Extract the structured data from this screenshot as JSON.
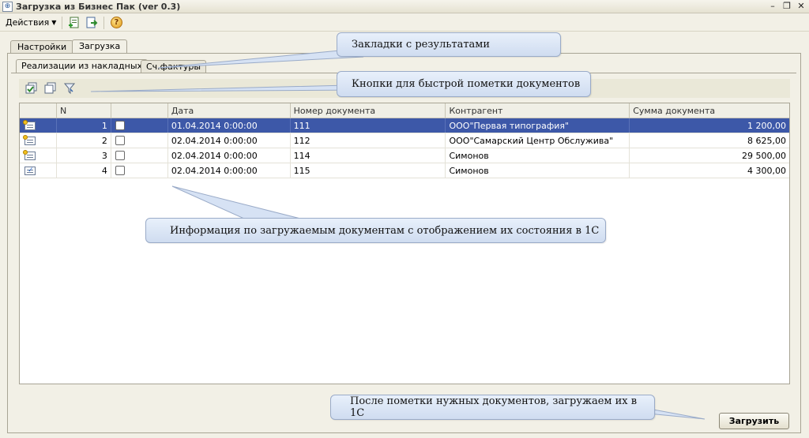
{
  "window": {
    "title": "Загрузка из Бизнес Пак (ver 0.3)"
  },
  "menu": {
    "actions_label": "Действия"
  },
  "outer_tabs": [
    {
      "label": "Настройки",
      "active": false
    },
    {
      "label": "Загрузка",
      "active": true
    }
  ],
  "inner_tabs": [
    {
      "label": "Реализации из накладных",
      "active": true
    },
    {
      "label": "Сч.фактуры",
      "active": false
    }
  ],
  "table": {
    "columns": [
      "",
      "N",
      "",
      "Дата",
      "Номер документа",
      "Контрагент",
      "Сумма документа"
    ],
    "rows": [
      {
        "n": "1",
        "date": "01.04.2014 0:00:00",
        "number": "111",
        "counterparty": "ООО\"Первая типография\"",
        "sum": "1 200,00",
        "selected": true,
        "icon": "document-new-icon"
      },
      {
        "n": "2",
        "date": "02.04.2014 0:00:00",
        "number": "112",
        "counterparty": "ООО\"Самарский Центр Обслужива\"",
        "sum": "8 625,00",
        "selected": false,
        "icon": "document-new-icon"
      },
      {
        "n": "3",
        "date": "02.04.2014 0:00:00",
        "number": "114",
        "counterparty": "Симонов",
        "sum": "29 500,00",
        "selected": false,
        "icon": "document-new-icon"
      },
      {
        "n": "4",
        "date": "02.04.2014 0:00:00",
        "number": "115",
        "counterparty": "Симонов",
        "sum": "4 300,00",
        "selected": false,
        "icon": "document-posted-icon"
      }
    ]
  },
  "callouts": {
    "tabs": "Закладки с результатами",
    "buttons": "Кнопки для быстрой пометки  документов",
    "info": "Информация по загружаемым документам с отображением их состояния в 1С",
    "load": "После пометки нужных документов, загружаем их в 1С"
  },
  "buttons": {
    "load_label": "Загрузить"
  },
  "icons": {
    "toolbar": [
      "add-document-icon",
      "document-arrow-icon",
      "help-icon"
    ],
    "strip": [
      "check-all-icon",
      "uncheck-all-icon",
      "filter-icon"
    ]
  },
  "colors": {
    "selected_row": "#3d58a8",
    "callout_fill": "#dbe6f6",
    "window_bg": "#f2f0e6"
  }
}
